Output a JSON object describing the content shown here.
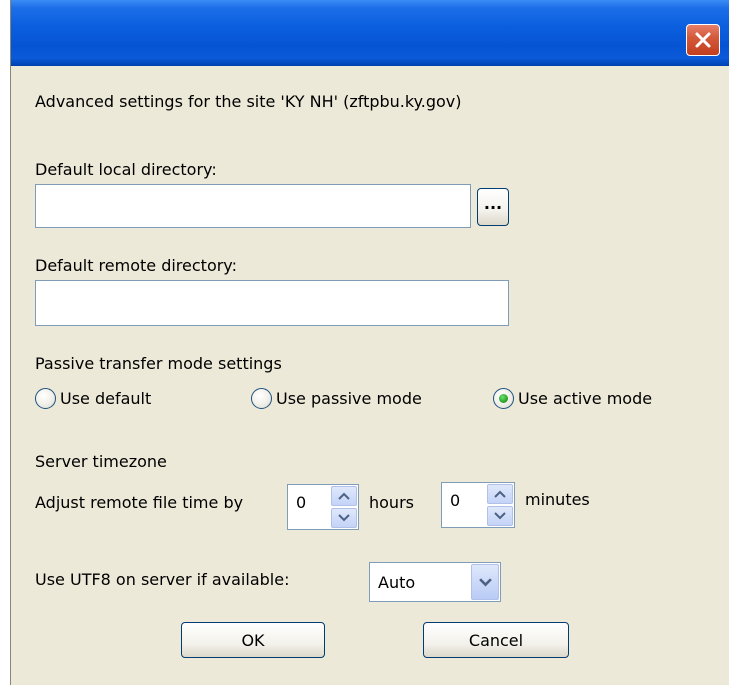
{
  "dialog": {
    "heading": "Advanced settings for the site 'KY NH' (zftpbu.ky.gov)"
  },
  "local_dir": {
    "label": "Default local directory:",
    "value": "",
    "browse_label": "..."
  },
  "remote_dir": {
    "label": "Default remote directory:",
    "value": ""
  },
  "passive": {
    "heading": "Passive transfer mode settings",
    "options": [
      {
        "label": "Use default",
        "selected": false
      },
      {
        "label": "Use passive mode",
        "selected": false
      },
      {
        "label": "Use active mode",
        "selected": true
      }
    ]
  },
  "timezone": {
    "heading": "Server timezone",
    "adjust_label": "Adjust remote file time by",
    "hours_value": "0",
    "hours_label": "hours",
    "minutes_value": "0",
    "minutes_label": "minutes"
  },
  "utf8": {
    "label": "Use UTF8 on server if available:",
    "selected": "Auto"
  },
  "buttons": {
    "ok": "OK",
    "cancel": "Cancel"
  },
  "colors": {
    "titlebar": "#0654d4",
    "close_button": "#c23e1e",
    "dialog_background": "#ece9d8",
    "radio_selected": "#2aa52a"
  }
}
